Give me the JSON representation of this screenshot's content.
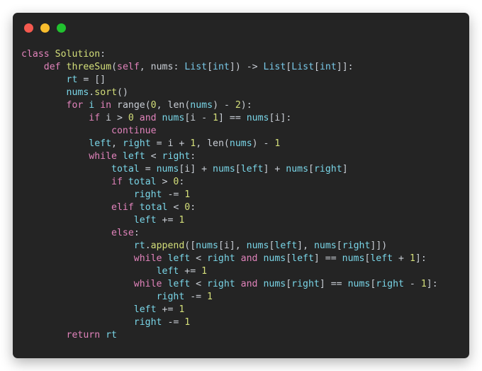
{
  "window": {
    "background_color": "#ffffff",
    "frame_color": "#242424",
    "controls": [
      {
        "name": "close",
        "label": "close-dot",
        "color": "#f4594f"
      },
      {
        "name": "minimize",
        "label": "minimize-dot",
        "color": "#f9bd2d"
      },
      {
        "name": "maximize",
        "label": "maximize-dot",
        "color": "#21c12f"
      }
    ]
  },
  "theme": {
    "keyword_color": "#e183bb",
    "function_color": "#d4df7a",
    "variable_color": "#7ad6e8",
    "type_color": "#78c8e8",
    "number_color": "#d4df7a",
    "text_color": "#c8cdd4"
  },
  "code": {
    "language": "python",
    "lines": [
      "class Solution:",
      "    def threeSum(self, nums: List[int]) -> List[List[int]]:",
      "        rt = []",
      "        nums.sort()",
      "        for i in range(0, len(nums) - 2):",
      "            if i > 0 and nums[i - 1] == nums[i]:",
      "                continue",
      "            left, right = i + 1, len(nums) - 1",
      "            while left < right:",
      "                total = nums[i] + nums[left] + nums[right]",
      "                if total > 0:",
      "                    right -= 1",
      "                elif total < 0:",
      "                    left += 1",
      "                else:",
      "                    rt.append([nums[i], nums[left], nums[right]])",
      "                    while left < right and nums[left] == nums[left + 1]:",
      "                        left += 1",
      "                    while left < right and nums[right] == nums[right - 1]:",
      "                        right -= 1",
      "                    left += 1",
      "                    right -= 1",
      "        return rt"
    ],
    "tokens": [
      [
        [
          "class ",
          "kw"
        ],
        [
          "Solution",
          "fn"
        ],
        [
          ":",
          "pun"
        ]
      ],
      [
        [
          "    ",
          "pun"
        ],
        [
          "def ",
          "kw"
        ],
        [
          "threeSum",
          "fn"
        ],
        [
          "(",
          "pun"
        ],
        [
          "self",
          "self"
        ],
        [
          ", ",
          "pun"
        ],
        [
          "nums",
          "prm"
        ],
        [
          ": ",
          "pun"
        ],
        [
          "List",
          "typ"
        ],
        [
          "[",
          "pun"
        ],
        [
          "int",
          "typ"
        ],
        [
          "]",
          "pun"
        ],
        [
          ") -> ",
          "pun"
        ],
        [
          "List",
          "typ"
        ],
        [
          "[",
          "pun"
        ],
        [
          "List",
          "typ"
        ],
        [
          "[",
          "pun"
        ],
        [
          "int",
          "typ"
        ],
        [
          "]]:",
          "pun"
        ]
      ],
      [
        [
          "        ",
          "pun"
        ],
        [
          "rt",
          "var"
        ],
        [
          " = []",
          "pun"
        ]
      ],
      [
        [
          "        ",
          "pun"
        ],
        [
          "nums",
          "var"
        ],
        [
          ".",
          "pun"
        ],
        [
          "sort",
          "fn"
        ],
        [
          "()",
          "pun"
        ]
      ],
      [
        [
          "        ",
          "pun"
        ],
        [
          "for ",
          "kw"
        ],
        [
          "i",
          "var"
        ],
        [
          " in ",
          "kw"
        ],
        [
          "range",
          "prm"
        ],
        [
          "(",
          "pun"
        ],
        [
          "0",
          "num"
        ],
        [
          ", ",
          "pun"
        ],
        [
          "len",
          "prm"
        ],
        [
          "(",
          "pun"
        ],
        [
          "nums",
          "var"
        ],
        [
          ") - ",
          "pun"
        ],
        [
          "2",
          "num"
        ],
        [
          "):",
          "pun"
        ]
      ],
      [
        [
          "            ",
          "pun"
        ],
        [
          "if ",
          "kw"
        ],
        [
          "i",
          "prm"
        ],
        [
          " > ",
          "pun"
        ],
        [
          "0",
          "num"
        ],
        [
          " and ",
          "kw"
        ],
        [
          "nums",
          "var"
        ],
        [
          "[",
          "pun"
        ],
        [
          "i",
          "prm"
        ],
        [
          " - ",
          "pun"
        ],
        [
          "1",
          "num"
        ],
        [
          "] == ",
          "pun"
        ],
        [
          "nums",
          "var"
        ],
        [
          "[",
          "pun"
        ],
        [
          "i",
          "prm"
        ],
        [
          "]:",
          "pun"
        ]
      ],
      [
        [
          "                ",
          "pun"
        ],
        [
          "continue",
          "kw"
        ]
      ],
      [
        [
          "            ",
          "pun"
        ],
        [
          "left",
          "var"
        ],
        [
          ", ",
          "pun"
        ],
        [
          "right",
          "var"
        ],
        [
          " = ",
          "pun"
        ],
        [
          "i",
          "prm"
        ],
        [
          " + ",
          "pun"
        ],
        [
          "1",
          "num"
        ],
        [
          ", ",
          "pun"
        ],
        [
          "len",
          "prm"
        ],
        [
          "(",
          "pun"
        ],
        [
          "nums",
          "var"
        ],
        [
          ") - ",
          "pun"
        ],
        [
          "1",
          "num"
        ]
      ],
      [
        [
          "            ",
          "pun"
        ],
        [
          "while ",
          "kw"
        ],
        [
          "left",
          "var"
        ],
        [
          " < ",
          "pun"
        ],
        [
          "right",
          "var"
        ],
        [
          ":",
          "pun"
        ]
      ],
      [
        [
          "                ",
          "pun"
        ],
        [
          "total",
          "var"
        ],
        [
          " = ",
          "pun"
        ],
        [
          "nums",
          "var"
        ],
        [
          "[",
          "pun"
        ],
        [
          "i",
          "prm"
        ],
        [
          "] + ",
          "pun"
        ],
        [
          "nums",
          "var"
        ],
        [
          "[",
          "pun"
        ],
        [
          "left",
          "var"
        ],
        [
          "] + ",
          "pun"
        ],
        [
          "nums",
          "var"
        ],
        [
          "[",
          "pun"
        ],
        [
          "right",
          "var"
        ],
        [
          "]",
          "pun"
        ]
      ],
      [
        [
          "                ",
          "pun"
        ],
        [
          "if ",
          "kw"
        ],
        [
          "total",
          "var"
        ],
        [
          " > ",
          "pun"
        ],
        [
          "0",
          "num"
        ],
        [
          ":",
          "pun"
        ]
      ],
      [
        [
          "                    ",
          "pun"
        ],
        [
          "right",
          "var"
        ],
        [
          " -= ",
          "pun"
        ],
        [
          "1",
          "num"
        ]
      ],
      [
        [
          "                ",
          "pun"
        ],
        [
          "elif ",
          "kw"
        ],
        [
          "total",
          "var"
        ],
        [
          " < ",
          "pun"
        ],
        [
          "0",
          "num"
        ],
        [
          ":",
          "pun"
        ]
      ],
      [
        [
          "                    ",
          "pun"
        ],
        [
          "left",
          "var"
        ],
        [
          " += ",
          "pun"
        ],
        [
          "1",
          "num"
        ]
      ],
      [
        [
          "                ",
          "pun"
        ],
        [
          "else",
          "kw"
        ],
        [
          ":",
          "pun"
        ]
      ],
      [
        [
          "                    ",
          "pun"
        ],
        [
          "rt",
          "var"
        ],
        [
          ".",
          "pun"
        ],
        [
          "append",
          "fn"
        ],
        [
          "([",
          "pun"
        ],
        [
          "nums",
          "var"
        ],
        [
          "[",
          "pun"
        ],
        [
          "i",
          "prm"
        ],
        [
          "], ",
          "pun"
        ],
        [
          "nums",
          "var"
        ],
        [
          "[",
          "pun"
        ],
        [
          "left",
          "var"
        ],
        [
          "], ",
          "pun"
        ],
        [
          "nums",
          "var"
        ],
        [
          "[",
          "pun"
        ],
        [
          "right",
          "var"
        ],
        [
          "]])",
          "pun"
        ]
      ],
      [
        [
          "                    ",
          "pun"
        ],
        [
          "while ",
          "kw"
        ],
        [
          "left",
          "var"
        ],
        [
          " < ",
          "pun"
        ],
        [
          "right",
          "var"
        ],
        [
          " and ",
          "kw"
        ],
        [
          "nums",
          "var"
        ],
        [
          "[",
          "pun"
        ],
        [
          "left",
          "var"
        ],
        [
          "] == ",
          "pun"
        ],
        [
          "nums",
          "var"
        ],
        [
          "[",
          "pun"
        ],
        [
          "left",
          "var"
        ],
        [
          " + ",
          "pun"
        ],
        [
          "1",
          "num"
        ],
        [
          "]:",
          "pun"
        ]
      ],
      [
        [
          "                        ",
          "pun"
        ],
        [
          "left",
          "var"
        ],
        [
          " += ",
          "pun"
        ],
        [
          "1",
          "num"
        ]
      ],
      [
        [
          "                    ",
          "pun"
        ],
        [
          "while ",
          "kw"
        ],
        [
          "left",
          "var"
        ],
        [
          " < ",
          "pun"
        ],
        [
          "right",
          "var"
        ],
        [
          " and ",
          "kw"
        ],
        [
          "nums",
          "var"
        ],
        [
          "[",
          "pun"
        ],
        [
          "right",
          "var"
        ],
        [
          "] == ",
          "pun"
        ],
        [
          "nums",
          "var"
        ],
        [
          "[",
          "pun"
        ],
        [
          "right",
          "var"
        ],
        [
          " - ",
          "pun"
        ],
        [
          "1",
          "num"
        ],
        [
          "]:",
          "pun"
        ]
      ],
      [
        [
          "                        ",
          "pun"
        ],
        [
          "right",
          "var"
        ],
        [
          " -= ",
          "pun"
        ],
        [
          "1",
          "num"
        ]
      ],
      [
        [
          "                    ",
          "pun"
        ],
        [
          "left",
          "var"
        ],
        [
          " += ",
          "pun"
        ],
        [
          "1",
          "num"
        ]
      ],
      [
        [
          "                    ",
          "pun"
        ],
        [
          "right",
          "var"
        ],
        [
          " -= ",
          "pun"
        ],
        [
          "1",
          "num"
        ]
      ],
      [
        [
          "        ",
          "pun"
        ],
        [
          "return ",
          "kw"
        ],
        [
          "rt",
          "var"
        ]
      ]
    ]
  }
}
